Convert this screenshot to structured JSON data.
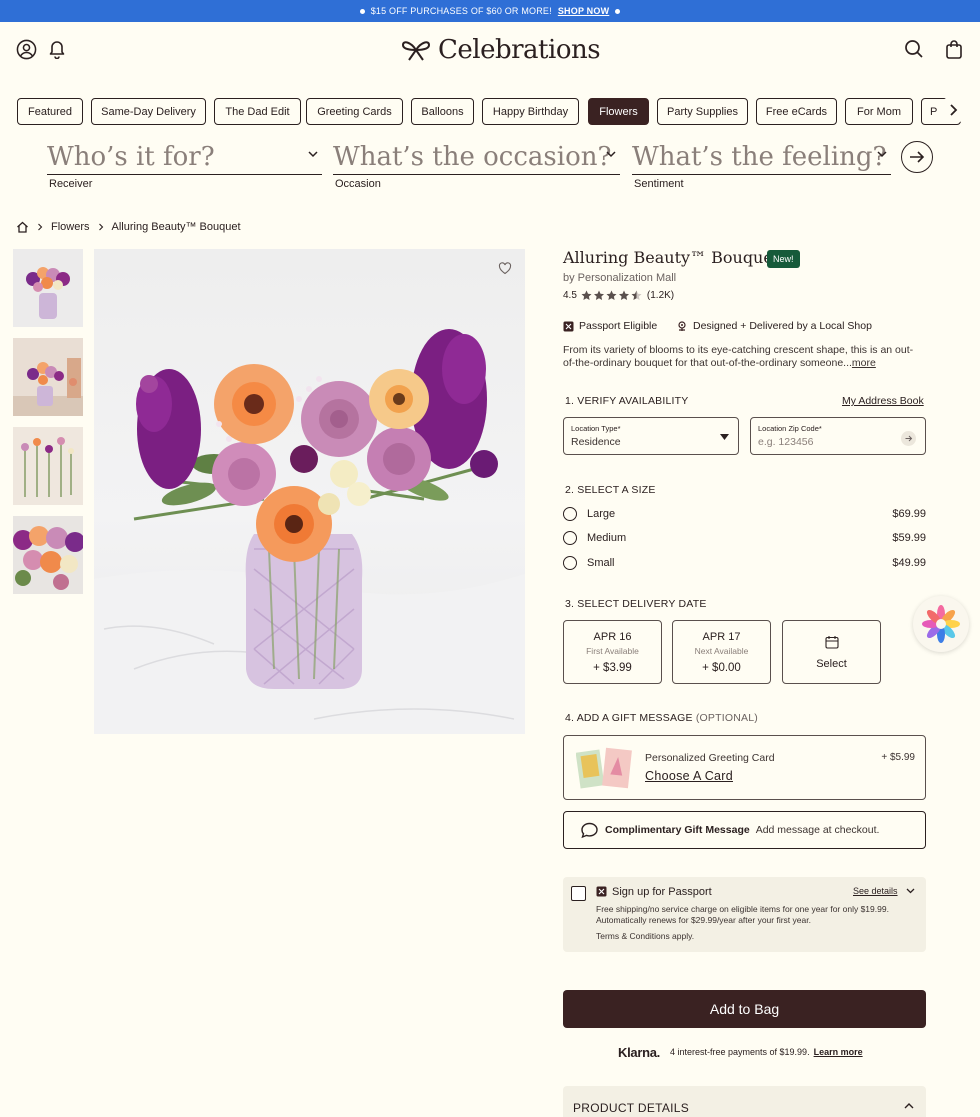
{
  "promo": {
    "text": "$15 OFF PURCHASES OF $60 OR MORE!",
    "link": "SHOP NOW"
  },
  "header": {
    "logo": "Celebrations"
  },
  "categories": [
    "Featured",
    "Same-Day Delivery",
    "The Dad Edit",
    "Greeting Cards",
    "Balloons",
    "Happy Birthday",
    "Flowers",
    "Party Supplies",
    "Free eCards",
    "For Mom",
    "P"
  ],
  "active_category": "Flowers",
  "finder": {
    "receiver": {
      "placeholder": "Who’s it for?",
      "label": "Receiver"
    },
    "occasion": {
      "placeholder": "What’s the occasion?",
      "label": "Occasion"
    },
    "sentiment": {
      "placeholder": "What’s the feeling?",
      "label": "Sentiment"
    }
  },
  "breadcrumb": [
    "Flowers",
    "Alluring Beauty™ Bouquet"
  ],
  "product": {
    "title": "Alluring Beauty™ Bouquet",
    "badge": "New!",
    "by": "by Personalization Mall",
    "rating": "4.5",
    "stars": 4.5,
    "reviews": "(1.2K)",
    "feature_1": "Passport Eligible",
    "feature_2": "Designed + Delivered by a Local Shop",
    "description": "From its variety of blooms to its eye-catching crescent shape, this is an out-of-the-ordinary bouquet for that out-of-the-ordinary someone...",
    "more": "more"
  },
  "availability": {
    "title": "1. VERIFY AVAILABILITY",
    "address_book": "My Address Book",
    "location_type_label": "Location Type*",
    "location_type_value": "Residence",
    "zip_label": "Location Zip Code*",
    "zip_placeholder": "e.g. 123456"
  },
  "size": {
    "title": "2. SELECT A SIZE",
    "options": [
      {
        "name": "Large",
        "price": "$69.99"
      },
      {
        "name": "Medium",
        "price": "$59.99"
      },
      {
        "name": "Small",
        "price": "$49.99"
      }
    ]
  },
  "delivery": {
    "title": "3. SELECT DELIVERY DATE",
    "dates": [
      {
        "date": "APR 16",
        "sub": "First Available",
        "price": "+ $3.99"
      },
      {
        "date": "APR 17",
        "sub": "Next Available",
        "price": "+ $0.00"
      }
    ],
    "select": "Select"
  },
  "gift": {
    "title": "4. ADD A GIFT MESSAGE",
    "optional": "(OPTIONAL)",
    "card_title": "Personalized Greeting Card",
    "card_link": "Choose A Card",
    "card_price": "+ $5.99",
    "msg_title": "Complimentary Gift Message",
    "msg_sub": "Add message at checkout."
  },
  "passport": {
    "title": "Sign up for Passport",
    "see_details": "See details",
    "line1": "Free shipping/no service charge on eligible items for one year for only $19.99.",
    "line2": "Automatically renews for $29.99/year after your first year.",
    "terms": "Terms & Conditions apply."
  },
  "cta": {
    "add_to_bag": "Add to Bag"
  },
  "klarna": {
    "brand": "Klarna.",
    "text": "4 interest-free payments of $19.99.",
    "link": "Learn more"
  },
  "details": {
    "title": "PRODUCT DETAILS"
  },
  "colors": {
    "promo": "#2f6fd6",
    "primary": "#3a2222",
    "new_badge": "#165a3a",
    "background": "#fffdf3",
    "panel": "#f3f0e4"
  }
}
